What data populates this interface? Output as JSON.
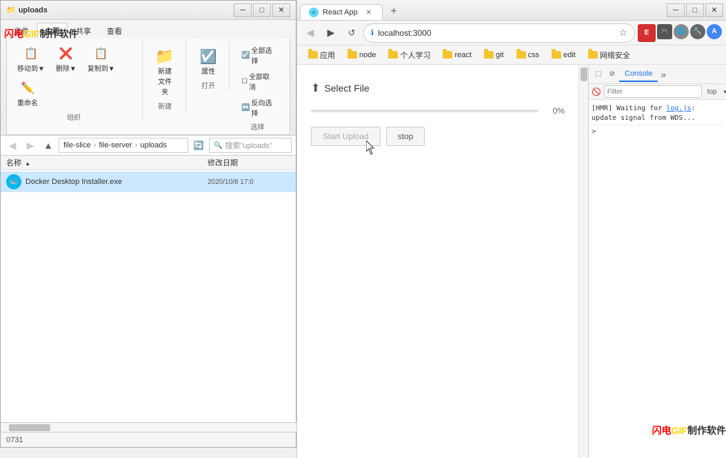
{
  "explorer": {
    "title": "uploads",
    "tabs": [
      "文件",
      "主页",
      "共享",
      "查看"
    ],
    "active_tab": "主页",
    "ribbon": {
      "groups": [
        {
          "label": "组织",
          "buttons": [
            {
              "icon": "📋",
              "label": "移动到▼"
            },
            {
              "icon": "❌",
              "label": "删除▼"
            },
            {
              "icon": "📋",
              "label": "复制到▼"
            },
            {
              "icon": "✏️",
              "label": "重命名"
            }
          ]
        },
        {
          "label": "新建",
          "buttons": [
            {
              "icon": "📁",
              "label": "新建\n文件夹"
            }
          ]
        },
        {
          "label": "打开",
          "buttons": [
            {
              "icon": "☑️",
              "label": "属性"
            }
          ]
        },
        {
          "label": "选择",
          "buttons": [
            {
              "icon": "☑️",
              "label": "全部选择"
            },
            {
              "icon": "☐",
              "label": "全部取消"
            },
            {
              "icon": "↔️",
              "label": "反向选择"
            }
          ]
        }
      ]
    },
    "path": {
      "segments": [
        "file-slice",
        "file-server",
        "uploads"
      ],
      "search_placeholder": "搜索\"uploads\""
    },
    "columns": {
      "name": "名称",
      "date": "修改日期"
    },
    "files": [
      {
        "name": "Docker Desktop Installer.exe",
        "date": "2020/10/8 17:0",
        "type": "docker"
      }
    ],
    "watermark": "闪电GIF制作软件"
  },
  "browser": {
    "tab_title": "React App",
    "tab_favicon": "⚛",
    "url": "localhost:3000",
    "bookmarks": [
      {
        "label": "应用",
        "type": "folder"
      },
      {
        "label": "node",
        "type": "folder"
      },
      {
        "label": "个人学习",
        "type": "folder"
      },
      {
        "label": "react",
        "type": "folder"
      },
      {
        "label": "git",
        "type": "folder"
      },
      {
        "label": "css",
        "type": "folder"
      },
      {
        "label": "edit",
        "type": "folder"
      },
      {
        "label": "网络安全",
        "type": "folder"
      }
    ],
    "webpage": {
      "select_file_label": "Select File",
      "progress_percent": "0%",
      "progress_value": 0,
      "start_upload_label": "Start Upload",
      "stop_label": "stop"
    },
    "devtools": {
      "tabs": [
        "Console"
      ],
      "toolbar": {
        "context": "top"
      },
      "console_messages": [
        {
          "text": "[HMR] Waiting for ",
          "link": "log.js",
          "text2": ": update signal from WDS..."
        }
      ],
      "prompt": ">"
    }
  },
  "watermark_br": "闪电GIF制作软件"
}
